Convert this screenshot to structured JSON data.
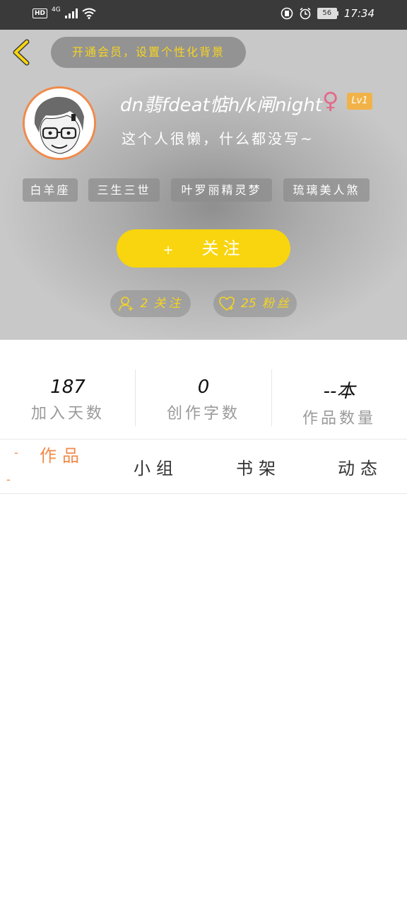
{
  "status_bar": {
    "network_hd": "HD",
    "network_gen": "4G",
    "battery": "56",
    "time": "17:34"
  },
  "header": {
    "vip_banner": "开通会员，设置个性化背景",
    "nickname": "dn翡fdeat惦h/k闸night",
    "gender_symbol": "♀",
    "level": "Lv1",
    "bio": "这个人很懒，什么都没写~",
    "tags": [
      "白羊座",
      "三生三世",
      "叶罗丽精灵梦",
      "琉璃美人煞"
    ],
    "follow_button": {
      "plus": "+",
      "label": "关注"
    },
    "following": {
      "count": "2",
      "label": "关注"
    },
    "fans": {
      "count": "25",
      "label": "粉丝"
    }
  },
  "stats": [
    {
      "value": "187",
      "label": "加入天数"
    },
    {
      "value": "0",
      "label": "创作字数"
    },
    {
      "value": "--本",
      "label": "作品数量"
    }
  ],
  "tabs": [
    "作品",
    "小组",
    "书架",
    "动态"
  ],
  "colors": {
    "accent": "#f08a4b",
    "yellow": "#f8d50e",
    "gender": "#e46a8a",
    "level_bg": "#f1b348"
  }
}
